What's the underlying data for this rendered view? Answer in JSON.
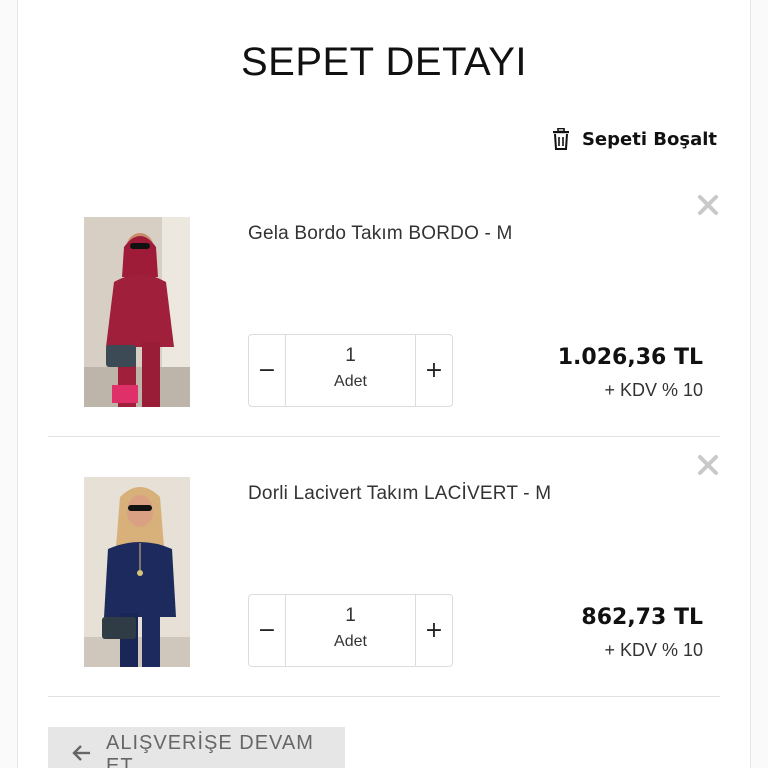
{
  "page": {
    "title": "SEPET DETAYI"
  },
  "toolbar": {
    "clear_cart_label": "Sepeti Boşalt",
    "clear_cart_icon": "trash-icon"
  },
  "cart": {
    "items": [
      {
        "name": "Gela Bordo Takım BORDO - M",
        "quantity": "1",
        "unit": "Adet",
        "price": "1.026,36 TL",
        "tax": "+ KDV % 10",
        "image_color": "#a01f3a"
      },
      {
        "name": "Dorli Lacivert Takım LACİVERT - M",
        "quantity": "1",
        "unit": "Adet",
        "price": "862,73 TL",
        "tax": "+ KDV % 10",
        "image_color": "#1d2a5e"
      }
    ],
    "decrement_symbol": "−",
    "increment_symbol": "+"
  },
  "footer": {
    "continue_label": "ALIŞVERİŞE DEVAM ET",
    "continue_icon": "arrow-left-icon"
  }
}
